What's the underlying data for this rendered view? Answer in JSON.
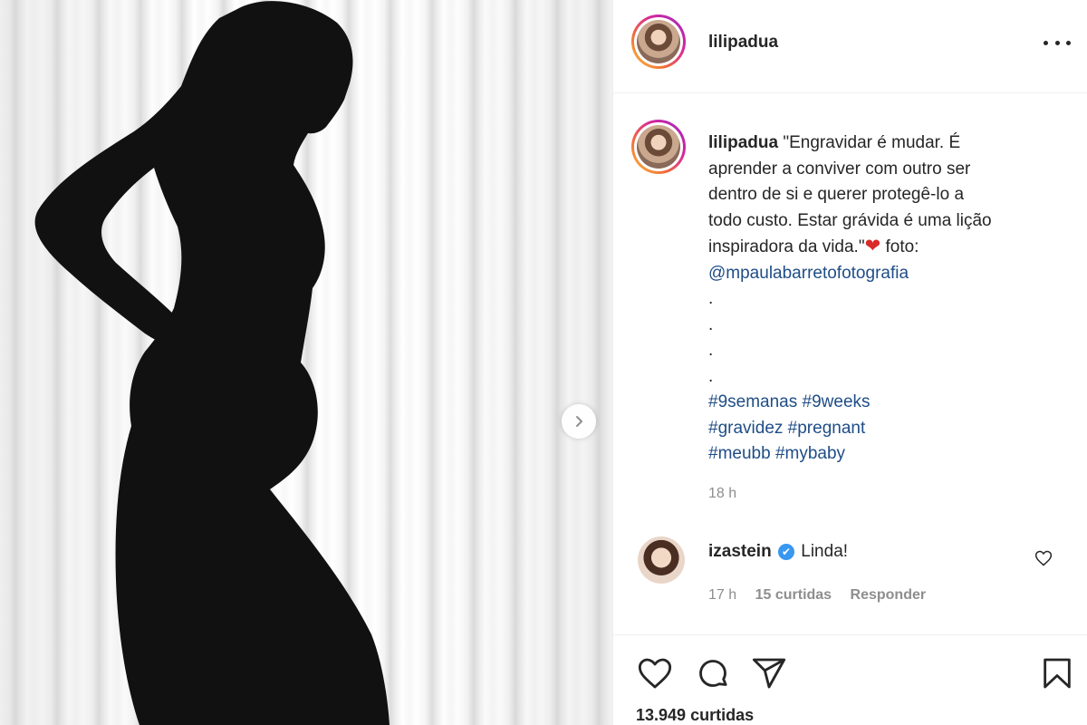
{
  "post": {
    "username": "lilipadua",
    "caption_username": "lilipadua",
    "caption_lines": [
      "\"Engravidar é mudar. É",
      "aprender a conviver com outro ser",
      "dentro de si e querer protegê-lo a",
      "todo custo. Estar grávida é uma lição"
    ],
    "caption_last_line": "inspiradora da vida.\"",
    "heart_emoji": "❤",
    "photo_credit_label": "foto:",
    "mention": "@mpaulabarretofotografia",
    "dots": [
      ".",
      ".",
      ".",
      "."
    ],
    "hashtags": [
      [
        "#9semanas",
        "#9weeks"
      ],
      [
        "#gravidez",
        "#pregnant"
      ],
      [
        "#meubb",
        "#mybaby"
      ]
    ],
    "time_ago": "18 h",
    "likes_count": "13.949",
    "likes_label": "curtidas"
  },
  "comment": {
    "username": "izastein",
    "verified_icon": "✔",
    "text": "Linda!",
    "time_ago": "17 h",
    "likes": "15 curtidas",
    "reply_label": "Responder"
  },
  "icons": {
    "more": "more-options-icon",
    "next": "chevron-right-icon",
    "like": "heart-outline-icon",
    "comment": "comment-bubble-icon",
    "share": "paper-plane-icon",
    "save": "bookmark-icon"
  },
  "colors": {
    "link": "#1f4d86",
    "muted": "#8e8e8e",
    "text": "#262626",
    "verified": "#3897f0"
  }
}
